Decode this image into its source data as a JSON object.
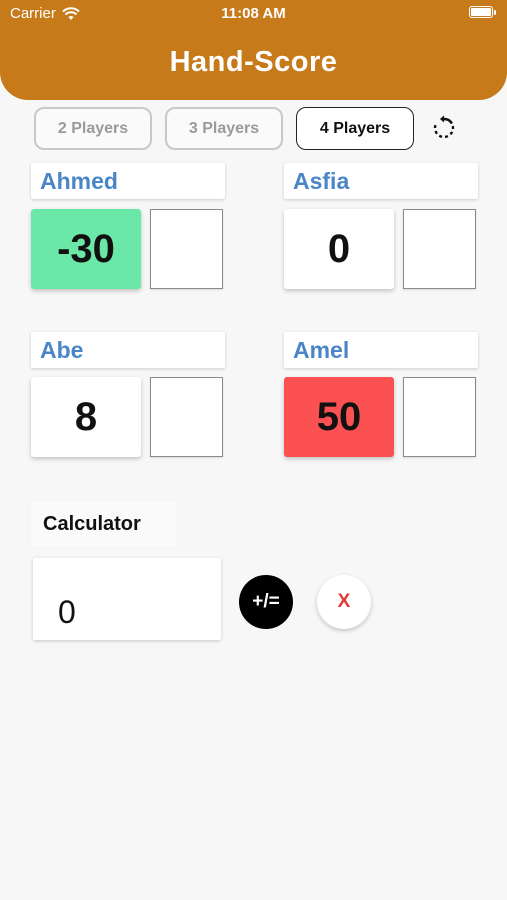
{
  "status_bar": {
    "carrier": "Carrier",
    "time": "11:08 AM"
  },
  "app": {
    "title": "Hand-Score"
  },
  "player_modes": [
    {
      "label": "2 Players",
      "active": false
    },
    {
      "label": "3 Players",
      "active": false
    },
    {
      "label": "4 Players",
      "active": true
    }
  ],
  "reset_icon": "refresh-icon",
  "players": [
    {
      "name": "Ahmed",
      "score": "-30",
      "score_color": "#6be8a8",
      "input_value": ""
    },
    {
      "name": "Asfia",
      "score": "0",
      "score_color": "#ffffff",
      "input_value": ""
    },
    {
      "name": "Abe",
      "score": "8",
      "score_color": "#ffffff",
      "input_value": ""
    },
    {
      "name": "Amel",
      "score": "50",
      "score_color": "#fc5152",
      "input_value": ""
    }
  ],
  "calculator": {
    "label": "Calculator",
    "value": "0",
    "plus_equals_label": "+/=",
    "clear_label": "X"
  },
  "colors": {
    "appbar": "#c67a1a",
    "name_text": "#4a86c7",
    "clear_x": "#e53935"
  }
}
